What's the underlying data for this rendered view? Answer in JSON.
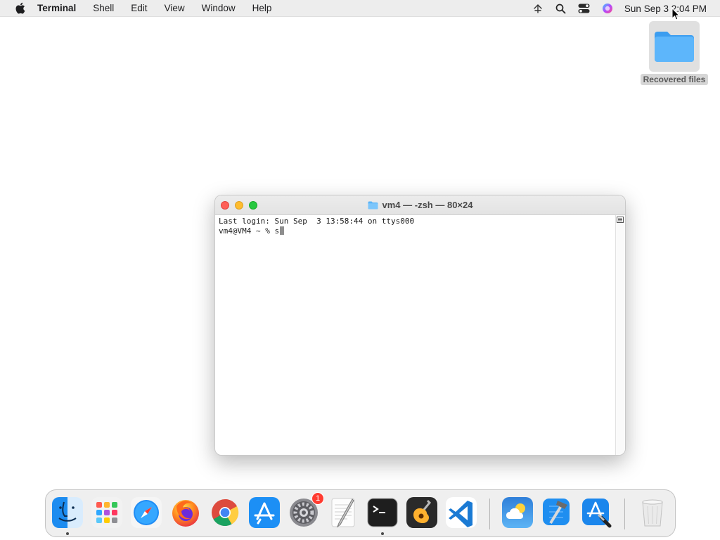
{
  "menubar": {
    "apple_icon": "apple-icon",
    "app_name": "Terminal",
    "items": [
      "Shell",
      "Edit",
      "View",
      "Window",
      "Help"
    ],
    "status_icons": [
      "network-icon",
      "search-icon",
      "control-center-icon",
      "siri-icon"
    ],
    "clock": "Sun Sep 3  2:04 PM"
  },
  "desktop": {
    "folder_label": "Recovered files",
    "folder_icon": "folder-icon"
  },
  "terminal": {
    "title": "vm4 — -zsh — 80×24",
    "lines": [
      "Last login: Sun Sep  3 13:58:44 on ttys000",
      "vm4@VM4 ~ % s"
    ]
  },
  "dock": {
    "apps": [
      {
        "name": "Finder",
        "icon": "finder-icon",
        "running": true
      },
      {
        "name": "Launchpad",
        "icon": "launchpad-icon",
        "running": false
      },
      {
        "name": "Safari",
        "icon": "safari-icon",
        "running": false
      },
      {
        "name": "Firefox",
        "icon": "firefox-icon",
        "running": false
      },
      {
        "name": "Chrome",
        "icon": "chrome-icon",
        "running": false
      },
      {
        "name": "App Store",
        "icon": "app-store-icon",
        "running": false
      },
      {
        "name": "System Settings",
        "icon": "system-settings-icon",
        "running": false,
        "badge": "1"
      },
      {
        "name": "TextEdit",
        "icon": "textedit-icon",
        "running": false
      },
      {
        "name": "Terminal",
        "icon": "terminal-icon",
        "running": true
      },
      {
        "name": "GarageBand",
        "icon": "garageband-icon",
        "running": false
      },
      {
        "name": "Visual Studio Code",
        "icon": "vscode-icon",
        "running": false
      },
      {
        "name": "Weather",
        "icon": "weather-icon",
        "running": false
      },
      {
        "name": "Xcode",
        "icon": "xcode-icon",
        "running": false
      },
      {
        "name": "Developer",
        "icon": "developer-icon",
        "running": false
      },
      {
        "name": "Trash",
        "icon": "trash-icon",
        "running": false
      }
    ]
  },
  "colors": {
    "close": "#fe5f57",
    "minimize": "#febc2e",
    "zoom": "#28c840",
    "badge": "#ff3b30"
  }
}
